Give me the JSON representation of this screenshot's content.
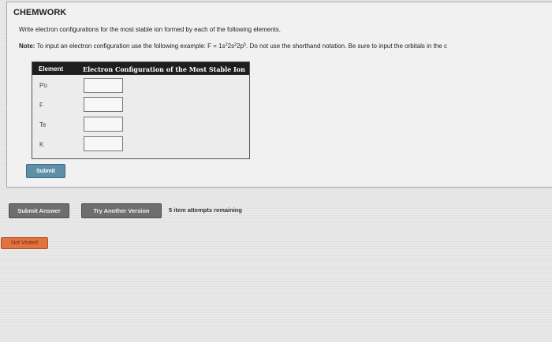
{
  "panel": {
    "title": "CHEMWORK",
    "instruction": "Write electron configurations for the most stable ion formed by each of the following elements.",
    "note_label": "Note:",
    "note_text_pre": "To input an electron configuration use the following example: F = 1s",
    "note_s1": "2",
    "note_mid1": "2s",
    "note_s2": "2",
    "note_mid2": "2p",
    "note_s3": "5",
    "note_text_post": ". Do not use the shorthand notation. Be sure to input the orbitals in the c"
  },
  "table": {
    "col_element": "Element",
    "col_configuration": "Electron Configuration of the Most Stable Ion",
    "rows": [
      {
        "element": "Po",
        "value": ""
      },
      {
        "element": "F",
        "value": ""
      },
      {
        "element": "Te",
        "value": ""
      },
      {
        "element": "K",
        "value": ""
      }
    ]
  },
  "buttons": {
    "submit": "Submit",
    "submit_answer": "Submit Answer",
    "try_another": "Try Another Version"
  },
  "attempts_text": "5 item attempts remaining",
  "status": "Not Visited"
}
